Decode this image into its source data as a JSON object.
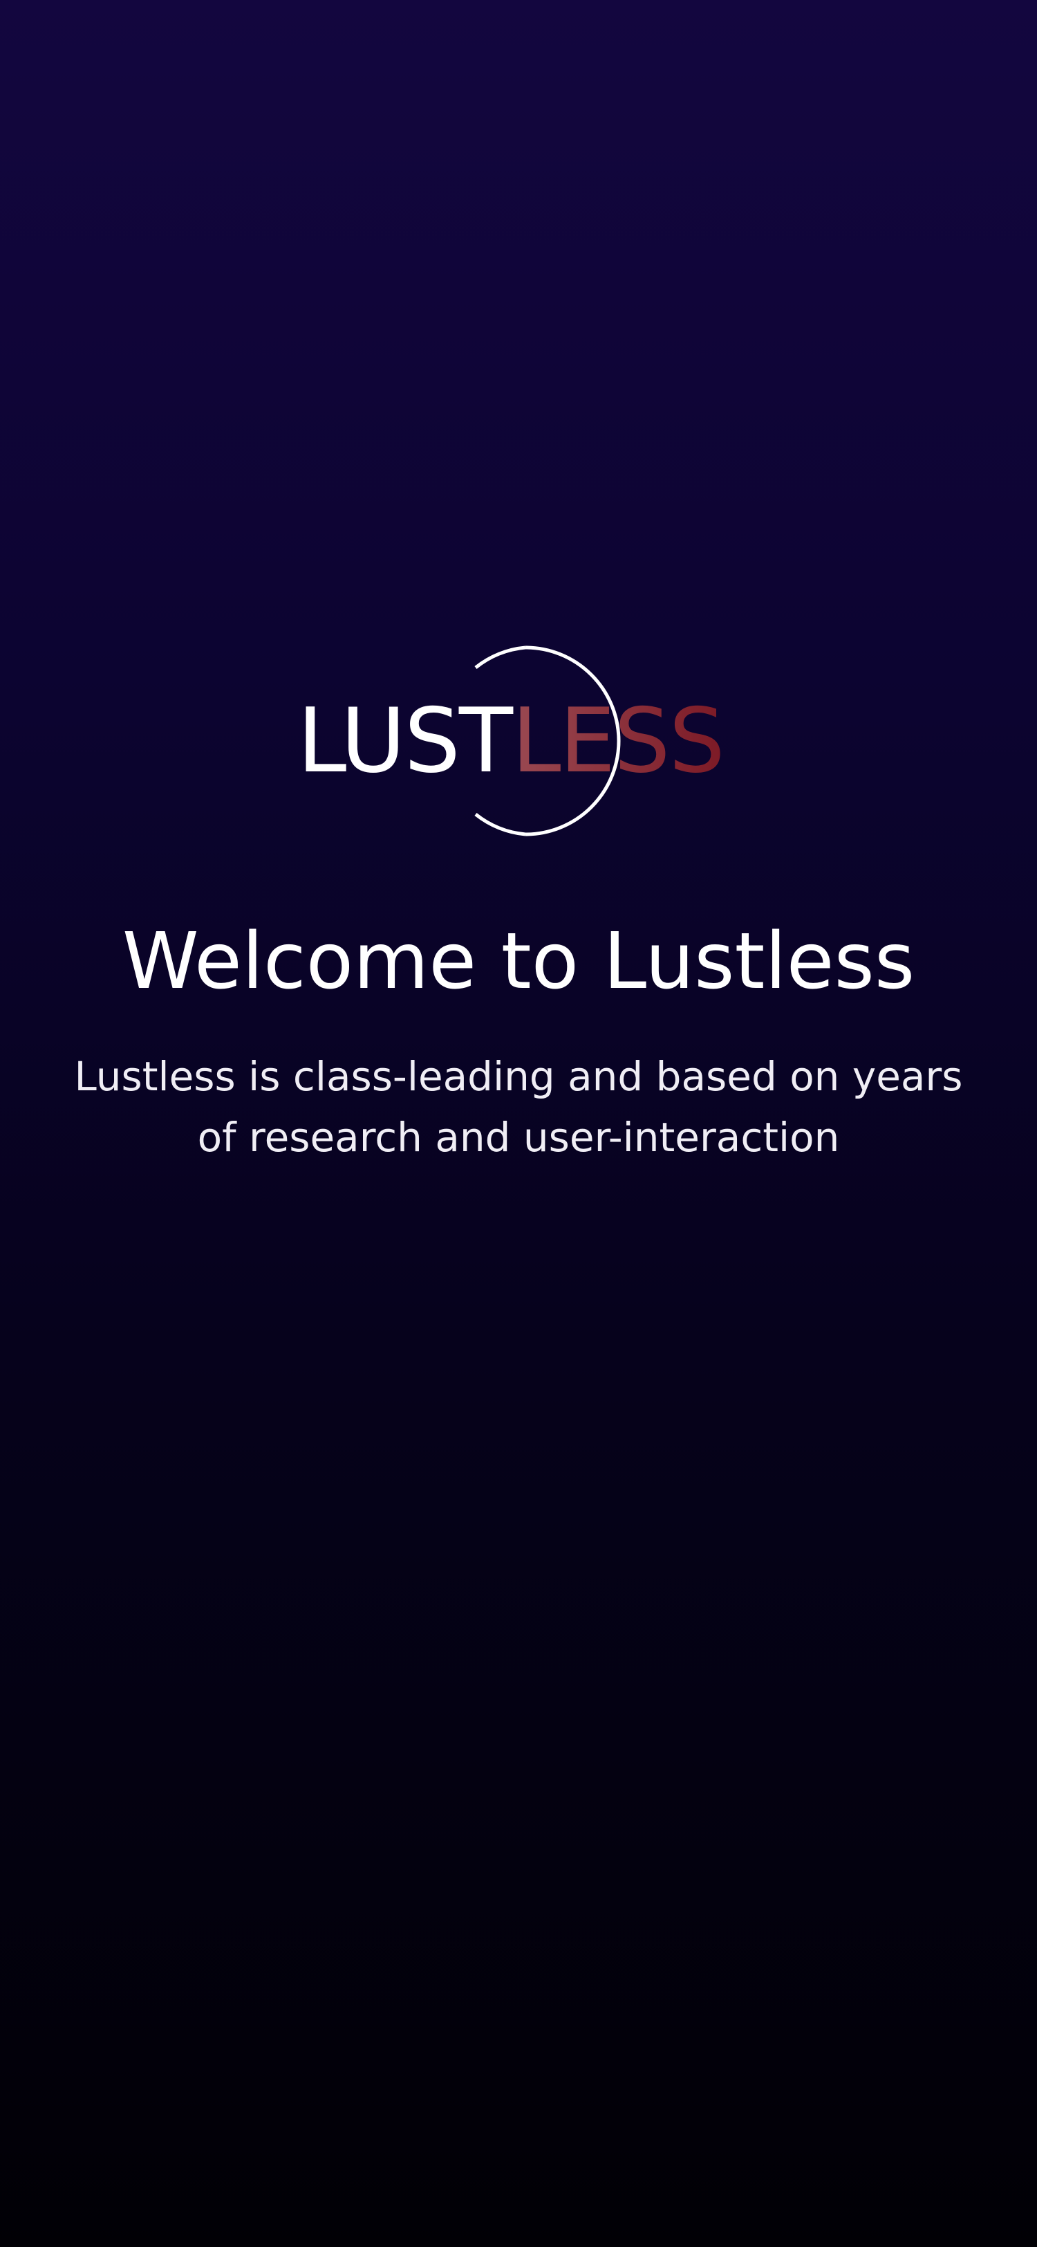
{
  "logo": {
    "text_primary": "LUST",
    "text_accent": "LESS",
    "accent_gradient": [
      "#b7787e",
      "#7d1a26"
    ],
    "ring_color": "#ffffff"
  },
  "welcome": {
    "title": "Welcome to Lustless",
    "subtitle": "Lustless is class-leading and based on years of research and user-interaction"
  },
  "colors": {
    "background_top": "#13063f",
    "background_bottom": "#010005",
    "text": "#ffffff"
  }
}
